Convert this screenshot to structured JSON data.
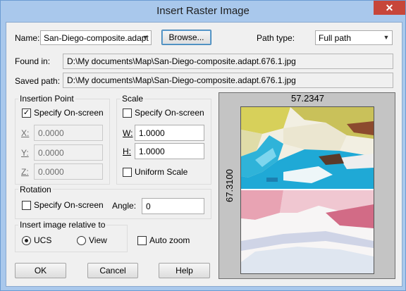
{
  "window": {
    "title": "Insert Raster Image",
    "close_glyph": "✕"
  },
  "name": {
    "label": "Name:",
    "accel": "N",
    "value": "San-Diego-composite.adapt"
  },
  "browse_label": "Browse...",
  "path_type": {
    "label": "Path type:",
    "value": "Full path"
  },
  "found_in": {
    "label": "Found in:",
    "value": "D:\\My documents\\Map\\San-Diego-composite.adapt.676.1.jpg"
  },
  "saved_path": {
    "label": "Saved path:",
    "value": "D:\\My documents\\Map\\San-Diego-composite.adapt.676.1.jpg"
  },
  "insertion": {
    "title": "Insertion Point",
    "specify_label": "Specify On-screen",
    "specify_checked": true,
    "x_label": "X:",
    "x_value": "0.0000",
    "y_label": "Y:",
    "y_value": "0.0000",
    "z_label": "Z:",
    "z_value": "0.0000"
  },
  "scale": {
    "title": "Scale",
    "specify_label": "Specify On-screen",
    "specify_checked": false,
    "w_label": "W:",
    "w_value": "1.0000",
    "h_label": "H:",
    "h_value": "1.0000",
    "uniform_label": "Uniform Scale",
    "uniform_checked": false
  },
  "rotation": {
    "title": "Rotation",
    "specify_label": "Specify On-screen",
    "specify_checked": false,
    "angle_label": "Angle:",
    "angle_value": "0"
  },
  "relative": {
    "title": "Insert image relative to",
    "ucs_label": "UCS",
    "view_label": "View",
    "selected": "UCS"
  },
  "auto_zoom": {
    "label": "Auto zoom",
    "checked": false
  },
  "buttons": {
    "ok": "OK",
    "cancel": "Cancel",
    "help": "Help"
  },
  "preview": {
    "width_text": "57.2347",
    "height_text": "67.3100"
  },
  "colors": {
    "title_bar": "#a9c8ec",
    "close_button": "#c7463a",
    "map_water": "#1fa9d6",
    "map_red": "#e8a3b3"
  }
}
